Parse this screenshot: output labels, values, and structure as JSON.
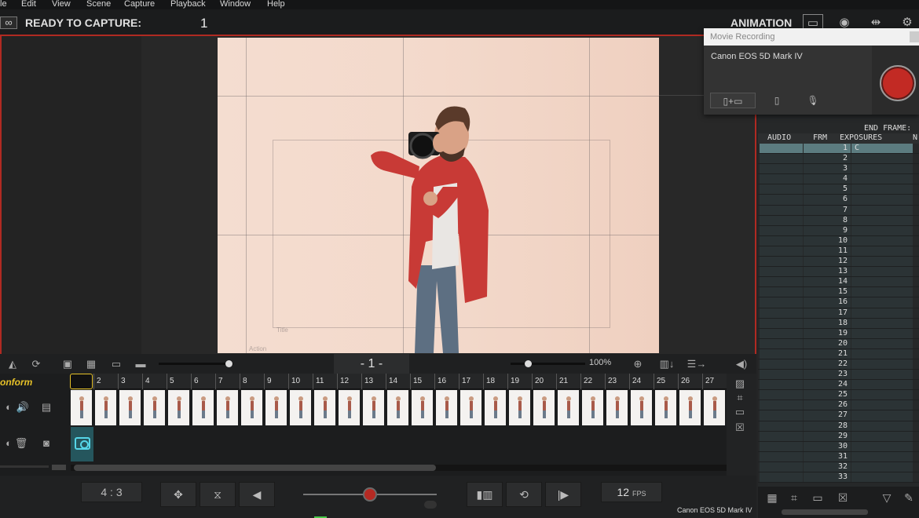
{
  "menu": [
    "le",
    "Edit",
    "View",
    "Scene",
    "Capture",
    "Playback",
    "Window",
    "Help"
  ],
  "topbar": {
    "status": "READY TO CAPTURE:",
    "frame": "1",
    "mode": "ANIMATION"
  },
  "viewer": {
    "guide_label": "Title",
    "guide_label2": "Action"
  },
  "popup": {
    "title": "Movie Recording",
    "camera": "Canon EOS 5D Mark IV",
    "record_color": "#c22a24"
  },
  "xsheet": {
    "end_frame": "END FRAME:",
    "columns": [
      "AUDIO",
      "FRM",
      "EXPOSURES",
      "N"
    ],
    "first_exposure": "C",
    "rows": [
      "1",
      "2",
      "3",
      "4",
      "5",
      "6",
      "7",
      "8",
      "9",
      "10",
      "11",
      "12",
      "13",
      "14",
      "15",
      "16",
      "17",
      "18",
      "19",
      "20",
      "21",
      "22",
      "23",
      "24",
      "25",
      "26",
      "27",
      "28",
      "29",
      "30",
      "31",
      "32",
      "33"
    ]
  },
  "controls": {
    "frame_indicator": "- 1 -",
    "zoom": "100%"
  },
  "timeline": {
    "conform": "onform",
    "ticks": [
      "2",
      "3",
      "4",
      "5",
      "6",
      "7",
      "8",
      "9",
      "10",
      "11",
      "12",
      "13",
      "14",
      "15",
      "16",
      "17",
      "18",
      "19",
      "20",
      "21",
      "22",
      "23",
      "24",
      "25",
      "26",
      "27"
    ],
    "thumb_count": 27
  },
  "bottom": {
    "ratio": "4 : 3",
    "fps_value": "12",
    "fps_unit": "FPS",
    "status_camera": "Canon EOS 5D Mark IV"
  },
  "colors": {
    "accent": "#b02a22",
    "selection": "#5c7c80",
    "conform": "#e6c128",
    "capture_track": "#25565d"
  }
}
